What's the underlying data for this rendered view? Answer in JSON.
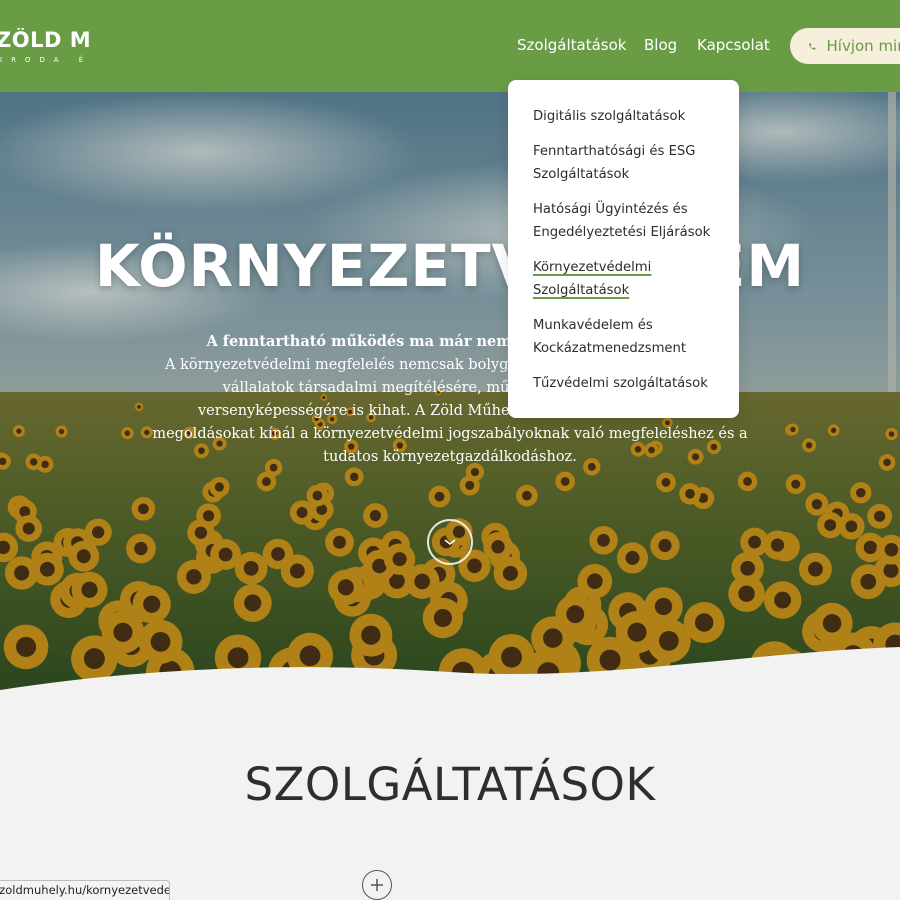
{
  "header": {
    "logo_text": "ZÖLD MŰHELY",
    "logo_sub": "IRODA ÉS SZOLGÁLTATÁS CE",
    "nav": {
      "services": "Szolgáltatások",
      "blog": "Blog",
      "contact": "Kapcsolat"
    },
    "call_button": "Hívjon minket"
  },
  "dropdown": {
    "items": [
      {
        "label": "Digitális szolgáltatások"
      },
      {
        "label": "Fenntarthatósági és ESG Szolgáltatások"
      },
      {
        "label": "Hatósági Ügyintézés és Engedélyeztetési Eljárások"
      },
      {
        "label": "Környezetvédelmi Szolgáltatások"
      },
      {
        "label": "Munkavédelem és Kockázatmenedzsment"
      },
      {
        "label": "Tűzvédelmi szolgáltatások"
      }
    ],
    "active_index": 3
  },
  "hero": {
    "title": "KÖRNYEZETVÉDELEM",
    "lead_bold": "A fenntartható működés ma már nem opció, hanem elvárás.",
    "lead_text": "A környezetvédelmi megfelelés nemcsak bolygónk védelmét szolgálja, hanem vállalatok társadalmi megítélésére, működési engedélyeire és versenyképességére is kihat. A Zöld Műhely szakértő csapata átfogó megoldásokat kínál a környezetvédelmi jogszabályoknak való megfeleléshez és a tudatos környezetgazdálkodáshoz."
  },
  "services_section": {
    "title": "SZOLGÁLTATÁSOK"
  },
  "status_bar": {
    "url": "https://zoldmuhely.hu/kornyezetvedelmi-szolgaltatasok/"
  },
  "colors": {
    "brand_green": "#6a9c46",
    "cream": "#f6efdc",
    "section_bg": "#f2f2f2",
    "heading_dark": "#2e2e2e"
  },
  "icons": {
    "phone": "phone-icon",
    "scroll": "chevron-down-icon",
    "plus": "plus-icon"
  }
}
